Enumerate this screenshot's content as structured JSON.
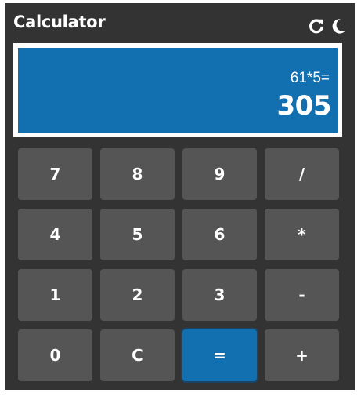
{
  "app": {
    "title": "Calculator",
    "colors": {
      "background": "#333333",
      "display": "#1270b0",
      "key": "#555555",
      "equals_key": "#1270b0",
      "text": "#ffffff"
    },
    "icons": [
      "refresh-icon",
      "moon-icon"
    ]
  },
  "display": {
    "expression": "61*5=",
    "result": "305"
  },
  "keys": [
    {
      "label": "7"
    },
    {
      "label": "8"
    },
    {
      "label": "9"
    },
    {
      "label": "/"
    },
    {
      "label": "4"
    },
    {
      "label": "5"
    },
    {
      "label": "6"
    },
    {
      "label": "*"
    },
    {
      "label": "1"
    },
    {
      "label": "2"
    },
    {
      "label": "3"
    },
    {
      "label": "-"
    },
    {
      "label": "0"
    },
    {
      "label": "C"
    },
    {
      "label": "="
    },
    {
      "label": "+"
    }
  ]
}
